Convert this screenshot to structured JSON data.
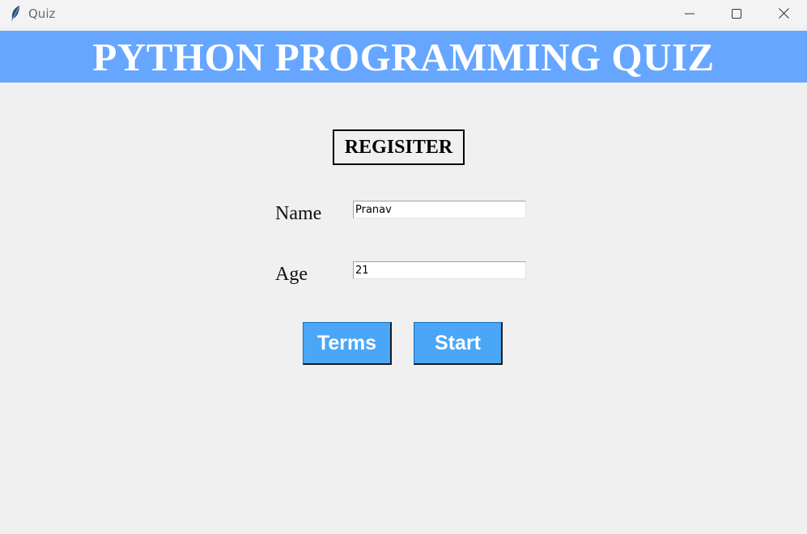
{
  "window": {
    "title": "Quiz",
    "icons": {
      "app": "feather-icon",
      "minimize": "minimize-icon",
      "maximize": "maximize-icon",
      "close": "close-icon"
    }
  },
  "banner": {
    "title": "PYTHON PROGRAMMING QUIZ",
    "background": "#66a6ff",
    "text_color": "#ffffff"
  },
  "form": {
    "heading": "REGISITER",
    "name_label": "Name",
    "name_value": "Pranav",
    "age_label": "Age",
    "age_value": "21"
  },
  "buttons": {
    "terms_label": "Terms",
    "start_label": "Start",
    "background": "#4aa6f6"
  }
}
